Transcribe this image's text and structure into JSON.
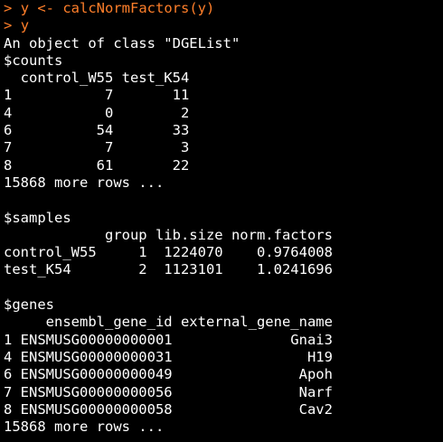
{
  "colors": {
    "background": "#000000",
    "prompt": "#ff7f2a",
    "output": "#ffffff"
  },
  "console": {
    "lines": [
      {
        "kind": "cmd",
        "prompt": ">",
        "text": "y <- calcNormFactors(y)"
      },
      {
        "kind": "cmd",
        "prompt": ">",
        "text": "y"
      },
      {
        "kind": "out",
        "text": "An object of class \"DGEList\""
      },
      {
        "kind": "out",
        "text": "$counts"
      },
      {
        "kind": "out",
        "text": "  control_W55 test_K54"
      },
      {
        "kind": "out",
        "text": "1           7       11"
      },
      {
        "kind": "out",
        "text": "4           0        2"
      },
      {
        "kind": "out",
        "text": "6          54       33"
      },
      {
        "kind": "out",
        "text": "7           7        3"
      },
      {
        "kind": "out",
        "text": "8          61       22"
      },
      {
        "kind": "out",
        "text": "15868 more rows ..."
      },
      {
        "kind": "out",
        "text": ""
      },
      {
        "kind": "out",
        "text": "$samples"
      },
      {
        "kind": "out",
        "text": "            group lib.size norm.factors"
      },
      {
        "kind": "out",
        "text": "control_W55     1  1224070    0.9764008"
      },
      {
        "kind": "out",
        "text": "test_K54        2  1123101    1.0241696"
      },
      {
        "kind": "out",
        "text": ""
      },
      {
        "kind": "out",
        "text": "$genes"
      },
      {
        "kind": "out",
        "text": "     ensembl_gene_id external_gene_name"
      },
      {
        "kind": "out",
        "text": "1 ENSMUSG00000000001              Gnai3"
      },
      {
        "kind": "out",
        "text": "4 ENSMUSG00000000031                H19"
      },
      {
        "kind": "out",
        "text": "6 ENSMUSG00000000049               Apoh"
      },
      {
        "kind": "out",
        "text": "7 ENSMUSG00000000056               Narf"
      },
      {
        "kind": "out",
        "text": "8 ENSMUSG00000000058               Cav2"
      },
      {
        "kind": "out",
        "text": "15868 more rows ..."
      }
    ]
  }
}
